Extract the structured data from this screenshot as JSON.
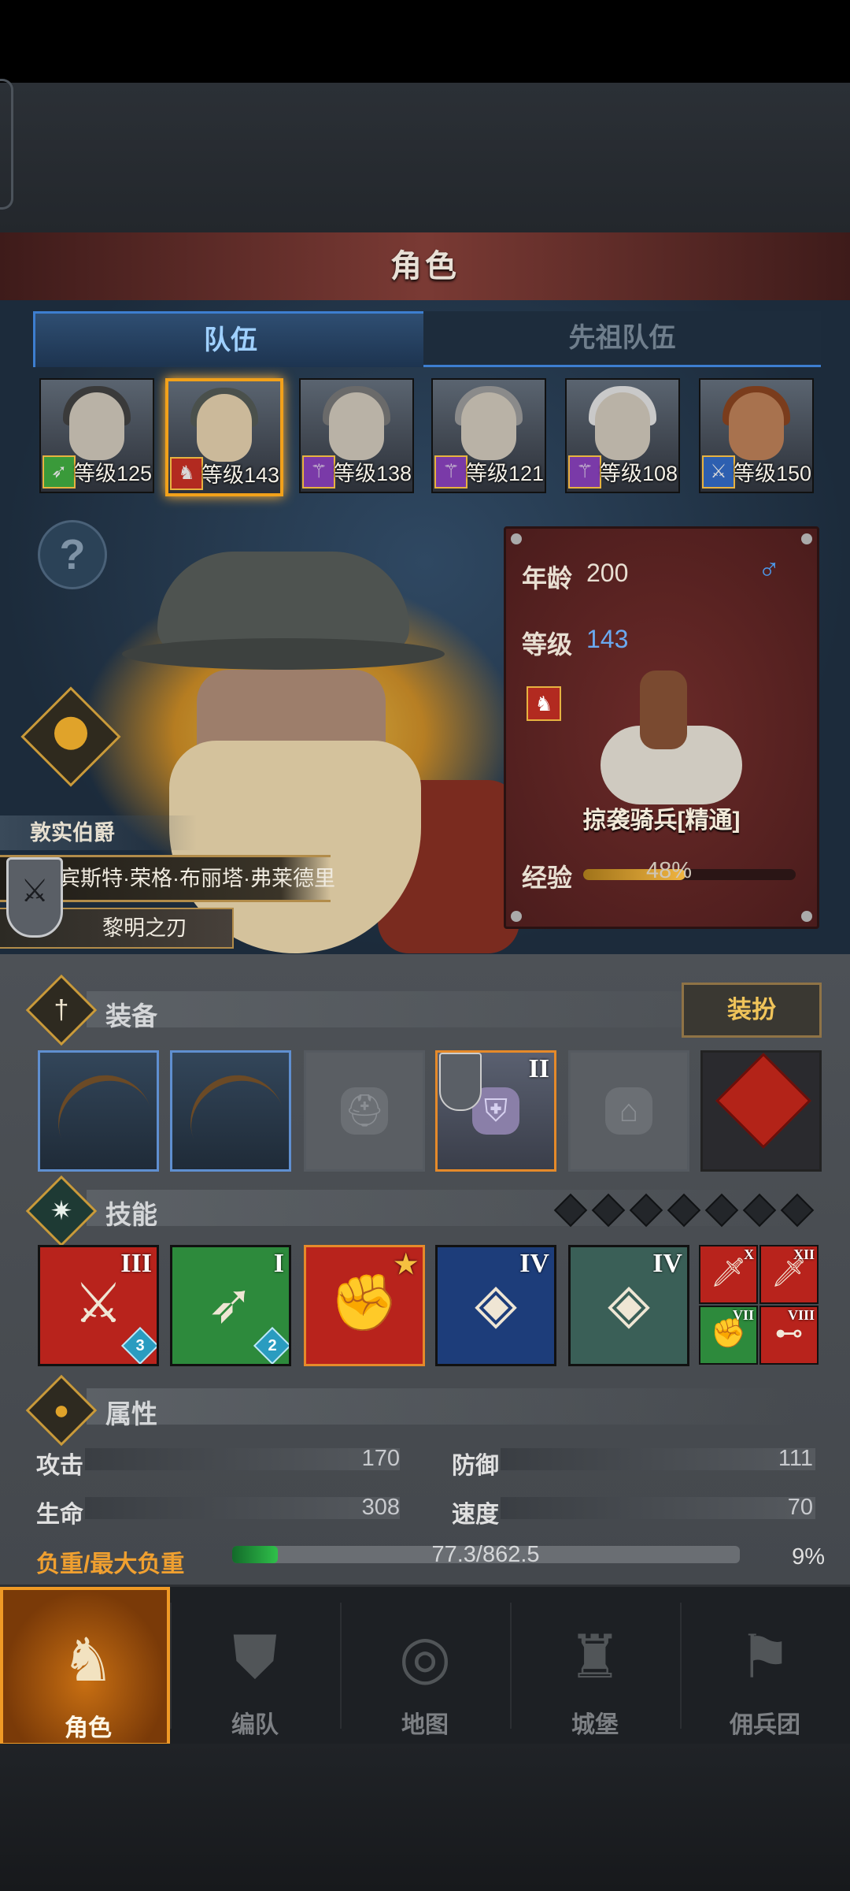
{
  "header": {
    "title": "角色"
  },
  "tabs": [
    {
      "label": "队伍"
    },
    {
      "label": "先祖队伍"
    }
  ],
  "heroes": [
    {
      "level_label": "等级125",
      "class_icon": "bow-icon"
    },
    {
      "level_label": "等级143",
      "class_icon": "horse-icon",
      "selected": true
    },
    {
      "level_label": "等级138",
      "class_icon": "staff-icon"
    },
    {
      "level_label": "等级121",
      "class_icon": "staff-icon"
    },
    {
      "level_label": "等级108",
      "class_icon": "staff-icon"
    },
    {
      "level_label": "等级150",
      "class_icon": "sword-icon"
    }
  ],
  "character": {
    "rank": "敦实伯爵",
    "name": "宾斯特·荣格·布丽塔·弗莱德里",
    "title": "黎明之刃"
  },
  "info": {
    "age_label": "年龄",
    "age_value": "200",
    "gender_symbol": "♂",
    "level_label": "等级",
    "level_value": "143",
    "unit_name": "掠袭骑兵[精通]",
    "exp_label": "经验",
    "exp_percent_text": "48%",
    "exp_fraction": 0.48
  },
  "equipment": {
    "title": "装备",
    "dress_button": "装扮",
    "slots": [
      {
        "type": "bow-icon",
        "state": "equipped"
      },
      {
        "type": "bow-icon",
        "state": "equipped"
      },
      {
        "type": "helmet-icon",
        "state": "empty"
      },
      {
        "type": "armor-icon",
        "state": "equipped",
        "tier": "II"
      },
      {
        "type": "boots-icon",
        "state": "empty"
      },
      {
        "type": "knot-charm-icon",
        "state": "equipped"
      }
    ]
  },
  "skills": {
    "title": "技能",
    "points_total": 7,
    "items": [
      {
        "tier": "III",
        "badge": "3",
        "color": "#b8231c"
      },
      {
        "tier": "I",
        "badge": "2",
        "color": "#2d8a3c"
      },
      {
        "tier": "★",
        "badge": "",
        "color": "#b8231c"
      },
      {
        "tier": "IV",
        "badge": "",
        "color": "#1d3d7a"
      },
      {
        "tier": "IV",
        "badge": "",
        "color": "#3a5f57"
      }
    ],
    "mini": [
      {
        "tier": "X",
        "color": "#b8231c"
      },
      {
        "tier": "XII",
        "color": "#b8231c"
      },
      {
        "tier": "VII",
        "color": "#2d8a3c"
      },
      {
        "tier": "VIII",
        "color": "#b8231c"
      }
    ]
  },
  "attributes": {
    "title": "属性",
    "attack_label": "攻击",
    "attack_value": "170",
    "defense_label": "防御",
    "defense_value": "111",
    "hp_label": "生命",
    "hp_value": "308",
    "speed_label": "速度",
    "speed_value": "70",
    "load_label": "负重/最大负重",
    "load_value": "77.3/862.5",
    "load_percent": "9%",
    "load_fraction": 0.09
  },
  "nav": [
    {
      "label": "角色",
      "icon": "knight-icon",
      "active": true
    },
    {
      "label": "编队",
      "icon": "formation-icon"
    },
    {
      "label": "地图",
      "icon": "compass-map-icon"
    },
    {
      "label": "城堡",
      "icon": "castle-icon"
    },
    {
      "label": "佣兵团",
      "icon": "mercenary-icon"
    }
  ],
  "colors": {
    "accent": "#f09a25",
    "tab_blue": "#3d7ed0",
    "card_red": "#5a2222"
  }
}
